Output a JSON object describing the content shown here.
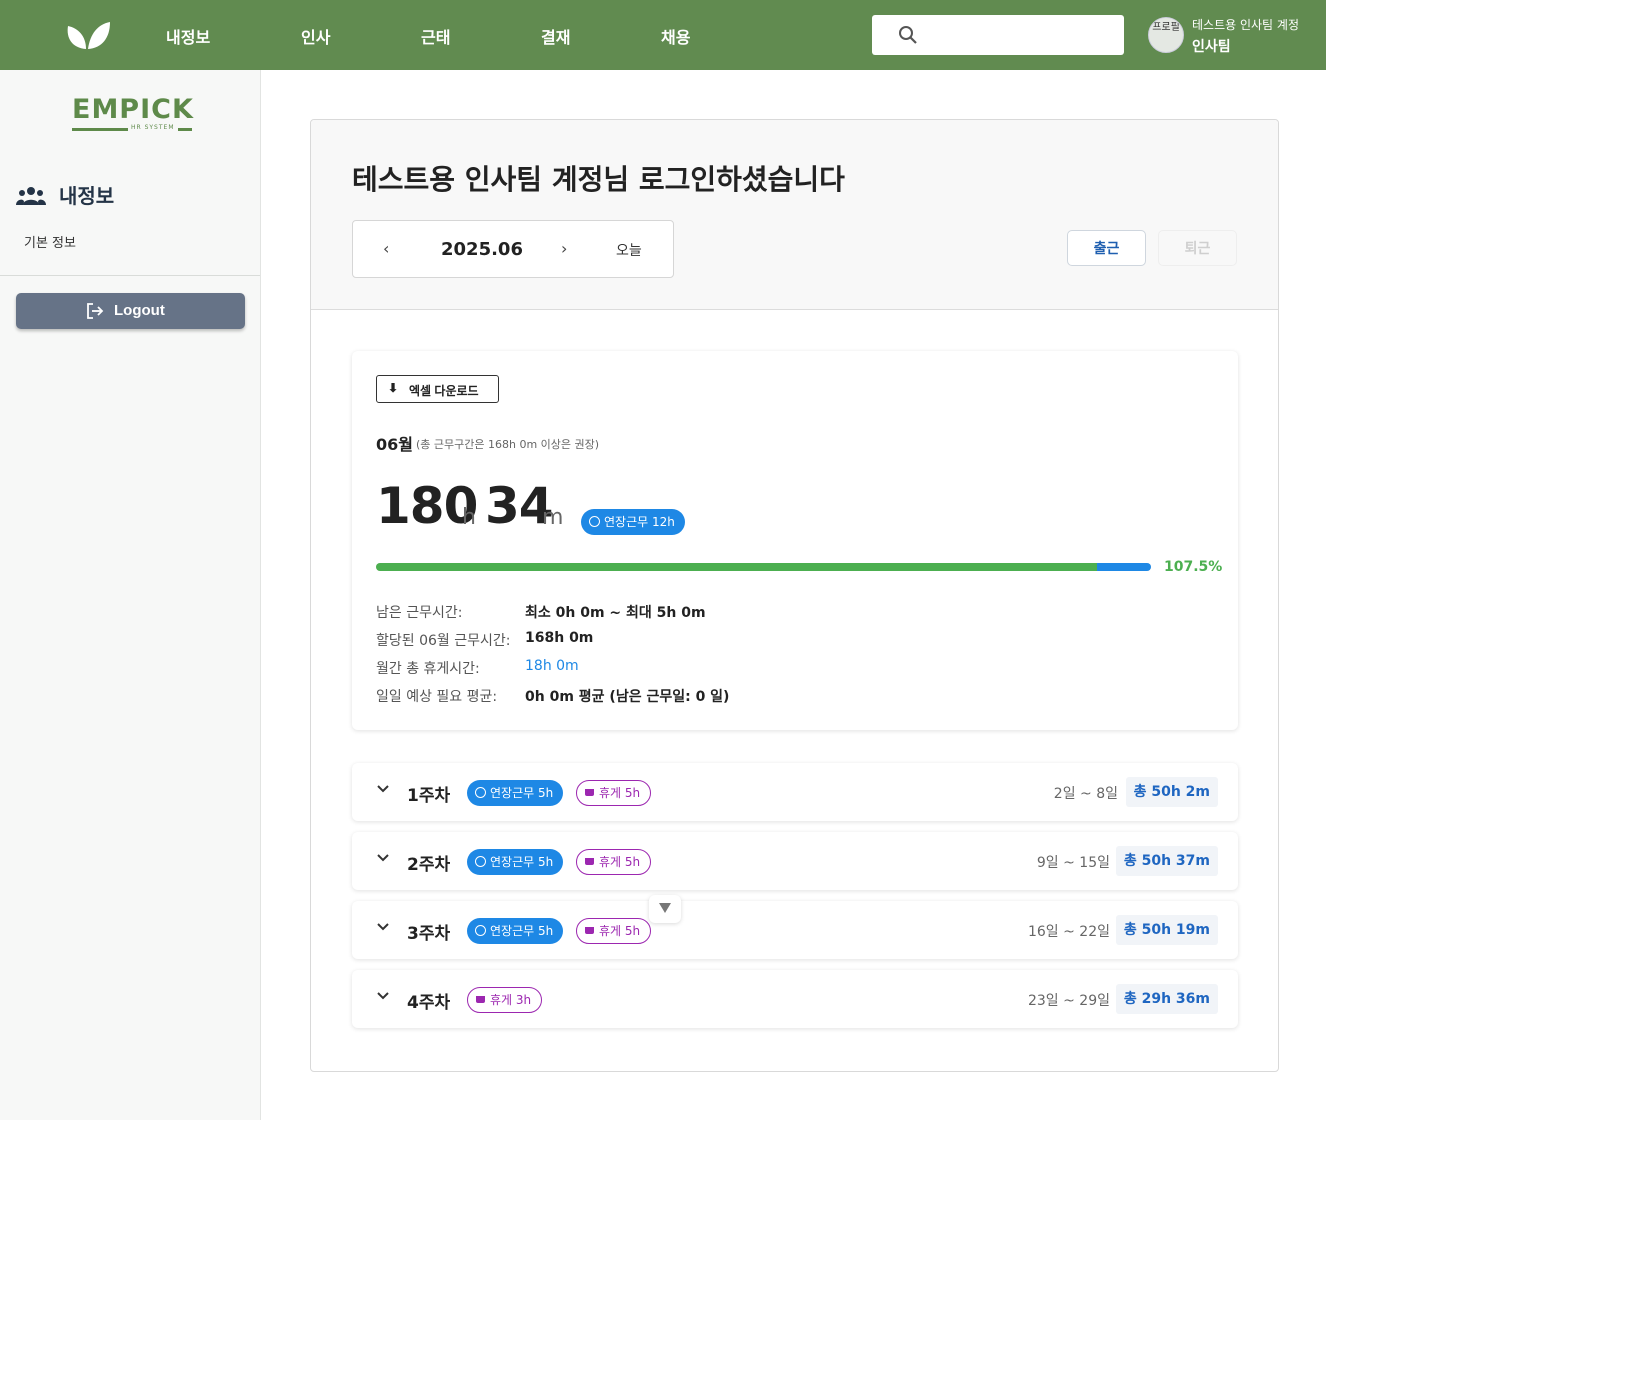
{
  "topbar": {
    "nav": [
      "내정보",
      "인사",
      "근태",
      "결재",
      "채용"
    ],
    "search_placeholder": "",
    "avatar_alt": "프로필",
    "user_account": "테스트용 인사팀 계정",
    "user_team": "인사팀",
    "color": "#618b50"
  },
  "sidebar": {
    "brand": "EMPICK",
    "brand_sub": "HR SYSTEM",
    "section_title": "내정보",
    "links": [
      "기본 정보"
    ],
    "logout_label": "Logout"
  },
  "header": {
    "welcome": "테스트용 인사팀 계정님 로그인하셨습니다",
    "date_label": "2025.06",
    "prev": "‹",
    "next": "›",
    "today_label": "오늘",
    "check_in_label": "출근",
    "check_out_label": "퇴근"
  },
  "summary": {
    "excel_label": "엑셀 다운로드",
    "month": "06월",
    "month_note": "(총 근무구간은 168h 0m 이상은 권장)",
    "total_hours": "180",
    "total_hours_unit": "h",
    "total_minutes": "34",
    "total_minutes_unit": "m",
    "overtime_badge": "연장근무 12h",
    "progress_percent_label": "107.5%",
    "progress_percent": 107.5,
    "stats": [
      {
        "label": "남은 근무시간:",
        "value": "최소 0h 0m ~ 최대 5h 0m"
      },
      {
        "label": "할당된 06월 근무시간:",
        "value": "168h 0m"
      },
      {
        "label": "월간 총 휴게시간:",
        "value": "18h 0m"
      },
      {
        "label": "일일 예상 필요 평균:",
        "value": "0h 0m 평균 (남은 근무일: 0 일)"
      }
    ]
  },
  "weeks": [
    {
      "label": "1주차",
      "overtime": "연장근무 5h",
      "rest": "휴게 5h",
      "range": "2일 ~ 8일",
      "total": "총 50h 2m"
    },
    {
      "label": "2주차",
      "overtime": "연장근무 5h",
      "rest": "휴게 5h",
      "range": "9일 ~ 15일",
      "total": "총 50h 37m"
    },
    {
      "label": "3주차",
      "overtime": "연장근무 5h",
      "rest": "휴게 5h",
      "range": "16일 ~ 22일",
      "total": "총 50h 19m"
    },
    {
      "label": "4주차",
      "overtime": "",
      "rest": "휴게 3h",
      "range": "23일 ~ 29일",
      "total": "총 29h 36m"
    }
  ],
  "colors": {
    "accent_green": "#4caf50",
    "accent_blue": "#1e88e5",
    "rest_purple": "#9c27b0",
    "logout_gray": "#667387"
  }
}
